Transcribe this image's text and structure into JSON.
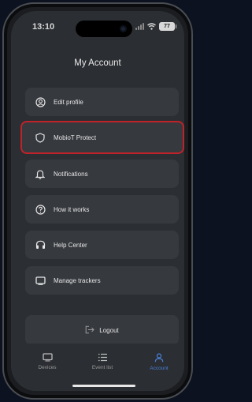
{
  "status_bar": {
    "time": "13:10",
    "battery": "77"
  },
  "header": {
    "title": "My Account"
  },
  "menu": [
    {
      "label": "Edit profile",
      "icon": "user-circle-icon"
    },
    {
      "label": "MobioT Protect",
      "icon": "shield-icon"
    },
    {
      "label": "Notifications",
      "icon": "bell-icon"
    },
    {
      "label": "How it works",
      "icon": "question-icon"
    },
    {
      "label": "Help Center",
      "icon": "headphones-icon"
    },
    {
      "label": "Manage trackers",
      "icon": "tracker-icon"
    }
  ],
  "logout": {
    "label": "Logout",
    "icon": "logout-icon"
  },
  "tabbar": {
    "devices": "Devices",
    "event_list": "Event list",
    "account": "Account"
  },
  "colors": {
    "highlight": "#c0222a",
    "active_tab": "#4a7fd6"
  }
}
